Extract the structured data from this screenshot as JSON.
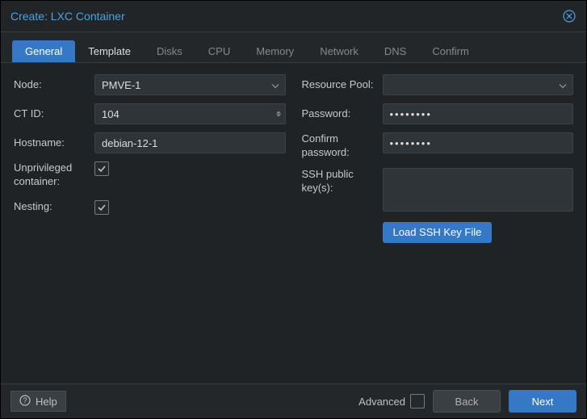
{
  "title": "Create: LXC Container",
  "tabs": [
    {
      "label": "General",
      "enabled": true,
      "active": true
    },
    {
      "label": "Template",
      "enabled": true,
      "active": false
    },
    {
      "label": "Disks",
      "enabled": false,
      "active": false
    },
    {
      "label": "CPU",
      "enabled": false,
      "active": false
    },
    {
      "label": "Memory",
      "enabled": false,
      "active": false
    },
    {
      "label": "Network",
      "enabled": false,
      "active": false
    },
    {
      "label": "DNS",
      "enabled": false,
      "active": false
    },
    {
      "label": "Confirm",
      "enabled": false,
      "active": false
    }
  ],
  "left": {
    "node_label": "Node:",
    "node_value": "PMVE-1",
    "ctid_label": "CT ID:",
    "ctid_value": "104",
    "hostname_label": "Hostname:",
    "hostname_value": "debian-12-1",
    "unpriv_label": "Unprivileged container:",
    "nesting_label": "Nesting:"
  },
  "right": {
    "pool_label": "Resource Pool:",
    "pool_value": "",
    "pw_label": "Password:",
    "pw_value": "••••••••",
    "cpw_label": "Confirm password:",
    "cpw_value": "••••••••",
    "ssh_label": "SSH public key(s):",
    "ssh_value": "",
    "load_btn": "Load SSH Key File"
  },
  "footer": {
    "help": "Help",
    "advanced": "Advanced",
    "back": "Back",
    "next": "Next"
  }
}
